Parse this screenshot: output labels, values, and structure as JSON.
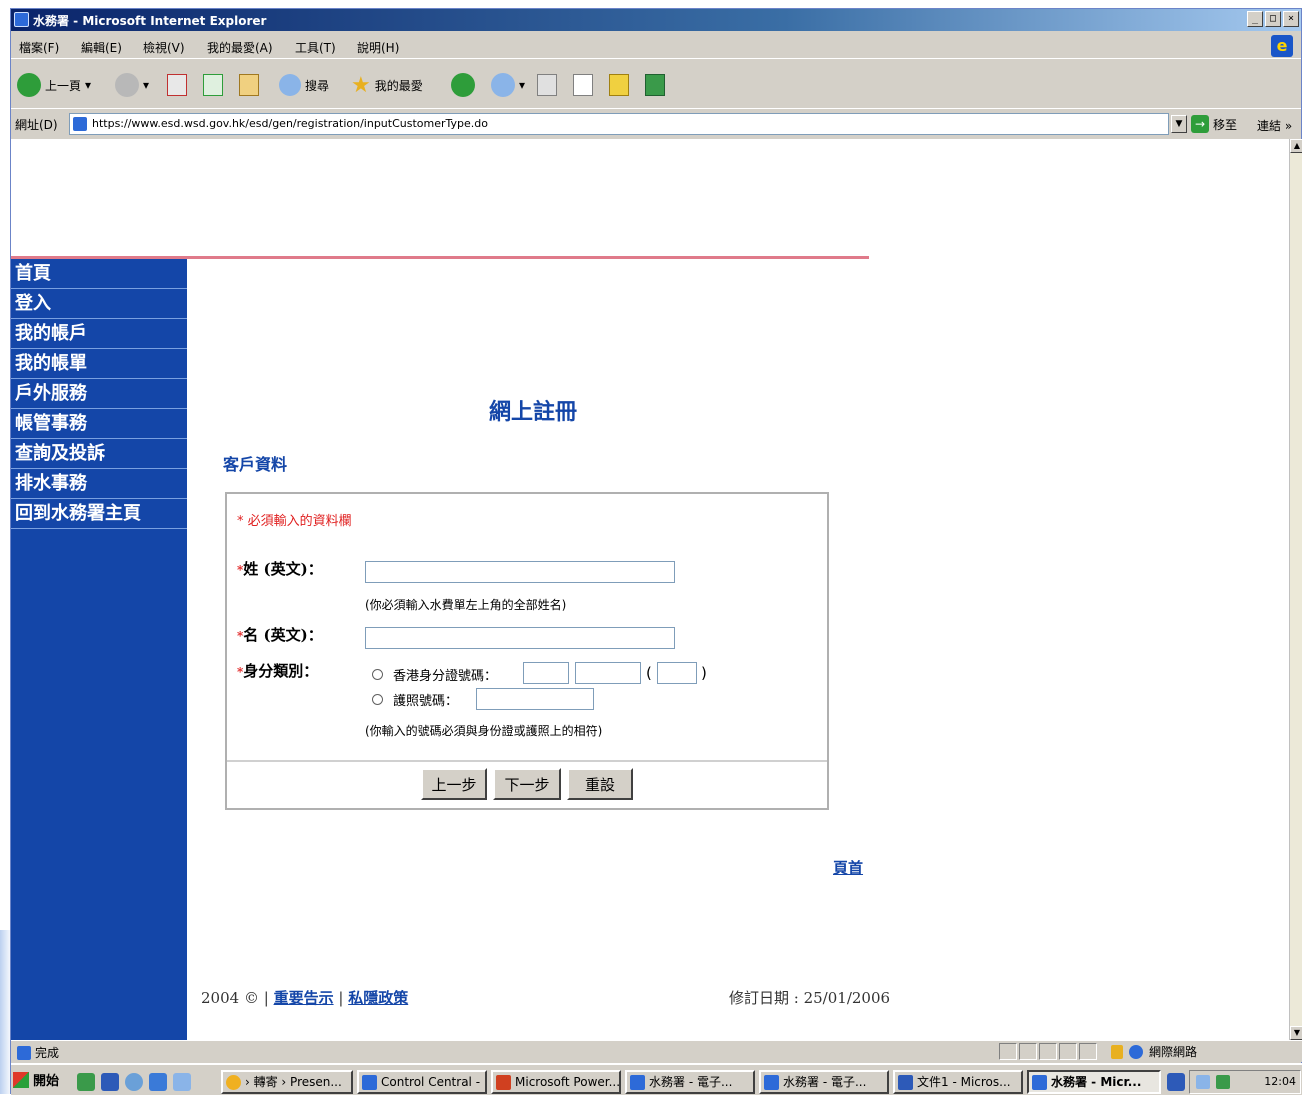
{
  "window": {
    "title": "水務署 - Microsoft Internet Explorer",
    "controls": [
      "_",
      "□",
      "×"
    ]
  },
  "menubar": [
    "檔案(F)",
    "編輯(E)",
    "檢視(V)",
    "我的最愛(A)",
    "工具(T)",
    "說明(H)"
  ],
  "toolbar": {
    "back": "上一頁",
    "search": "搜尋",
    "favorites": "我的最愛"
  },
  "address": {
    "label": "網址(D)",
    "url": "https://www.esd.wsd.gov.hk/esd/gen/registration/inputCustomerType.do",
    "go": "移至",
    "links": "連結 »"
  },
  "sidebar": {
    "items": [
      "首頁",
      "登入",
      "我的帳戶",
      "我的帳單",
      "戶外服務",
      "帳管事務",
      "查詢及投訴",
      "排水事務",
      "回到水務署主頁"
    ]
  },
  "page": {
    "title": "網上註冊",
    "section": "客戶資料",
    "required_note": "* 必須輸入的資料欄",
    "fields": {
      "surname_label": "姓 (英文)：",
      "surname_value": "",
      "surname_hint": "(你必須輸入水費單左上角的全部姓名)",
      "given_label": "名 (英文)：",
      "given_value": "",
      "id_type_label": "身分類別：",
      "hkid_label": "香港身分證號碼：",
      "passport_label": "護照號碼：",
      "id_hint": "(你輸入的號碼必須與身份證或護照上的相符)"
    },
    "buttons": {
      "prev": "上一步",
      "next": "下一步",
      "reset": "重設"
    },
    "top_link": "頁首",
    "footer": {
      "copyright": "2004 ©",
      "notice": "重要告示",
      "privacy": "私隱政策",
      "revised": "修訂日期 : 25/01/2006"
    }
  },
  "statusbar": {
    "text": "完成",
    "zone": "網際網路"
  },
  "taskbar": {
    "start": "開始",
    "tasks": [
      "› 轉寄 › Presen...",
      "Control Central - ...",
      "Microsoft Power...",
      "水務署 - 電子...",
      "水務署 - 電子...",
      "文件1 - Micros...",
      "水務署 - Micr..."
    ],
    "clock": "12:04"
  },
  "colors": {
    "sidebar": "#1446a8",
    "accent_line": "#e07a8a",
    "required": "#e02020",
    "link": "#1446a8"
  },
  "icons": [
    "ie-logo-icon",
    "back-icon",
    "forward-icon",
    "stop-icon",
    "refresh-icon",
    "home-icon",
    "search-icon",
    "favorites-icon",
    "history-icon",
    "mail-icon",
    "print-icon",
    "edit-icon",
    "messenger-icon",
    "page-icon",
    "go-icon",
    "lock-icon",
    "globe-icon"
  ]
}
